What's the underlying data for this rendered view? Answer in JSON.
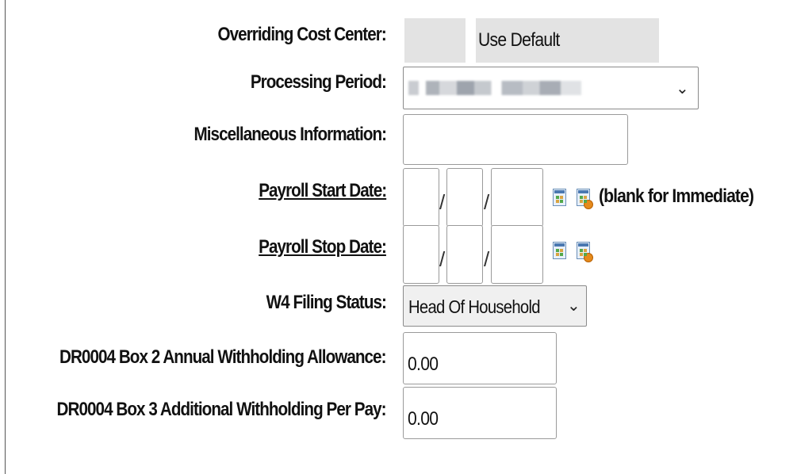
{
  "form": {
    "overriding_cost_center": {
      "label": "Overriding Cost Center:",
      "value": "Use Default"
    },
    "processing_period": {
      "label": "Processing Period:",
      "value_obscured": true
    },
    "misc_info": {
      "label": "Miscellaneous Information:",
      "value": ""
    },
    "payroll_start_date": {
      "label": "Payroll Start Date:",
      "month": "",
      "day": "",
      "year": "",
      "separator": "/",
      "note": "(blank for Immediate)"
    },
    "payroll_stop_date": {
      "label": "Payroll Stop Date:",
      "month": "",
      "day": "",
      "year": "",
      "separator": "/"
    },
    "w4_filing_status": {
      "label": "W4 Filing Status:",
      "value": "Head Of Household"
    },
    "dr0004_box2": {
      "label": "DR0004 Box 2 Annual Withholding Allowance:",
      "value": "0.00"
    },
    "dr0004_box3": {
      "label": "DR0004 Box 3 Additional Withholding Per Pay:",
      "value": "0.00"
    }
  },
  "icons": {
    "calendar": "calendar-icon",
    "clear_date": "clear-date-icon",
    "dropdown": "chevron-down-icon"
  },
  "colors": {
    "gray_field": "#e3e3e3",
    "badge": "#e58a1c"
  }
}
